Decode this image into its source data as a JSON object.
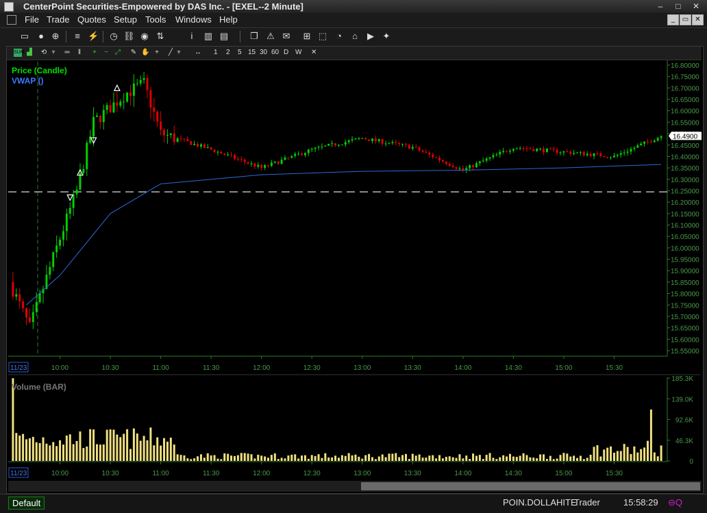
{
  "window": {
    "title": "CenterPoint Securities-Empowered by DAS Inc. - [EXEL--2 Minute]"
  },
  "menu": [
    "File",
    "Trade",
    "Quotes",
    "Setup",
    "Tools",
    "Windows",
    "Help"
  ],
  "chart_toolbar": {
    "periods": [
      "1",
      "2",
      "5",
      "15",
      "30",
      "60",
      "D",
      "W"
    ]
  },
  "chart": {
    "price_label": "Price (Candle)",
    "vwap_label": "VWAP ()",
    "volume_label": "Volume (BAR)",
    "date_label": "11/23",
    "current_price": "16.4900",
    "price_ticks": [
      "16.80000",
      "16.75000",
      "16.70000",
      "16.65000",
      "16.60000",
      "16.55000",
      "16.50000",
      "16.45000",
      "16.40000",
      "16.35000",
      "16.30000",
      "16.25000",
      "16.20000",
      "16.15000",
      "16.10000",
      "16.05000",
      "16.00000",
      "15.95000",
      "15.90000",
      "15.85000",
      "15.80000",
      "15.75000",
      "15.70000",
      "15.65000",
      "15.60000",
      "15.55000"
    ],
    "volume_ticks": [
      "185.3K",
      "139.0K",
      "92.6K",
      "46.3K",
      "0"
    ],
    "time_ticks": [
      "10:00",
      "10:30",
      "11:00",
      "11:30",
      "12:00",
      "12:30",
      "13:00",
      "13:30",
      "14:00",
      "14:30",
      "15:00",
      "15:30"
    ],
    "colors": {
      "up": "#00d000",
      "down": "#e00000",
      "vwap": "#2a6cd8",
      "volume": "#f0e080",
      "axis": "#2e7d2e"
    }
  },
  "chart_data": {
    "type": "candlestick",
    "title": "EXEL--2 Minute",
    "price_range": [
      15.55,
      16.8
    ],
    "volume_range": [
      0,
      185300
    ],
    "reference_line": 16.245,
    "current_price": 16.49,
    "x_range": [
      "09:30",
      "16:00"
    ],
    "key_points": [
      {
        "time": "09:30",
        "price": 15.85
      },
      {
        "time": "09:42",
        "price": 15.65
      },
      {
        "time": "09:58",
        "price": 16.0
      },
      {
        "time": "10:10",
        "price": 16.25
      },
      {
        "time": "10:20",
        "price": 16.55
      },
      {
        "time": "10:40",
        "price": 16.68
      },
      {
        "time": "10:50",
        "price": 16.72
      },
      {
        "time": "11:00",
        "price": 16.5
      },
      {
        "time": "11:30",
        "price": 16.43
      },
      {
        "time": "12:00",
        "price": 16.35
      },
      {
        "time": "12:30",
        "price": 16.43
      },
      {
        "time": "13:00",
        "price": 16.48
      },
      {
        "time": "13:30",
        "price": 16.44
      },
      {
        "time": "14:00",
        "price": 16.34
      },
      {
        "time": "14:30",
        "price": 16.44
      },
      {
        "time": "15:00",
        "price": 16.42
      },
      {
        "time": "15:30",
        "price": 16.4
      },
      {
        "time": "15:58",
        "price": 16.49
      }
    ],
    "vwap": [
      {
        "time": "09:40",
        "price": 15.75
      },
      {
        "time": "10:00",
        "price": 15.88
      },
      {
        "time": "10:30",
        "price": 16.15
      },
      {
        "time": "11:00",
        "price": 16.28
      },
      {
        "time": "12:00",
        "price": 16.32
      },
      {
        "time": "13:00",
        "price": 16.335
      },
      {
        "time": "14:00",
        "price": 16.34
      },
      {
        "time": "15:00",
        "price": 16.35
      },
      {
        "time": "15:58",
        "price": 16.365
      }
    ]
  },
  "status": {
    "default_tab": "Default",
    "user": "POIN.DOLLAHITE",
    "role": "Trader",
    "time": "15:58:29"
  }
}
